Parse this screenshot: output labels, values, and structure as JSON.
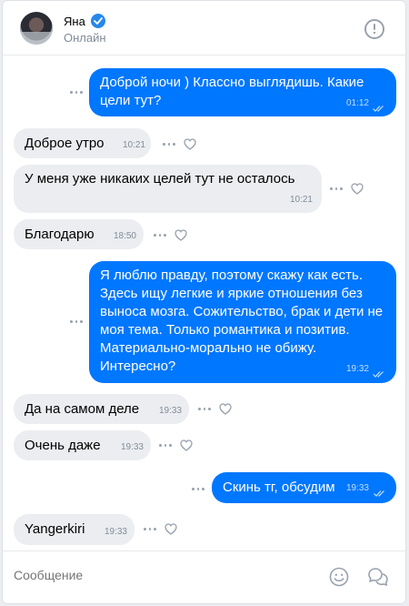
{
  "header": {
    "name": "Яна",
    "status": "Онлайн"
  },
  "messages": [
    {
      "dir": "out",
      "text": "Доброй ночи ) Классно выглядишь. Какие цели тут?",
      "time": "01:12"
    },
    {
      "dir": "in",
      "text": "Доброе утро",
      "time": "10:21"
    },
    {
      "dir": "in",
      "text": "У меня уже никаких целей тут не осталось",
      "time": "10:21"
    },
    {
      "dir": "in",
      "text": "Благодарю",
      "time": "18:50"
    },
    {
      "dir": "out",
      "text": "Я люблю правду, поэтому скажу как есть. Здесь ищу легкие и яркие отношения без выноса мозга. Сожительство, брак и дети не моя тема. Только романтика и позитив. Материально-морально не обижу. Интересно?",
      "time": "19:32"
    },
    {
      "dir": "in",
      "text": "Да на самом деле",
      "time": "19:33"
    },
    {
      "dir": "in",
      "text": "Очень даже",
      "time": "19:33"
    },
    {
      "dir": "out",
      "text": "Скинь тг, обсудим",
      "time": "19:33"
    },
    {
      "dir": "in",
      "text": "Yangerkiri",
      "time": "19:33"
    }
  ],
  "composer": {
    "placeholder": "Сообщение"
  },
  "icons": {
    "verified": "verified-check-icon",
    "alert": "alert-circle-icon",
    "more": "more-dots-icon",
    "like": "heart-icon",
    "read": "double-check-icon",
    "emoji": "smile-icon",
    "chats": "chat-bubbles-icon"
  },
  "colors": {
    "outgoing": "#0077ff",
    "incoming": "#ebedf0",
    "accent": "#2688eb"
  }
}
